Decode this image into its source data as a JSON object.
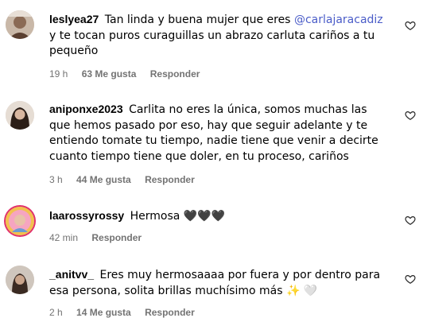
{
  "comments": [
    {
      "username": "leslyea27",
      "text_before": "Tan linda y buena mujer que eres ",
      "mention": "@carlajaracadiz",
      "text_after": " y te tocan puros curaguillas un abrazo carluta cariños a tu pequeño",
      "time": "19 h",
      "likes": "63 Me gusta",
      "reply": "Responder",
      "avatar_icon": "profile-photo",
      "heart_icon": "heart-outline-icon"
    },
    {
      "username": "aniponxe2023",
      "text": "Carlita no eres la única, somos muchas las que hemos pasado por eso, hay que seguir adelante y te entiendo tomate tu tiempo, nadie tiene que venir a decirte cuanto tiempo tiene que doler, en tu proceso, cariños",
      "time": "3 h",
      "likes": "44 Me gusta",
      "reply": "Responder",
      "avatar_icon": "profile-photo",
      "heart_icon": "heart-outline-icon"
    },
    {
      "username": "laarossyrossy",
      "text": "Hermosa 🖤🖤🖤",
      "time": "42 min",
      "reply": "Responder",
      "avatar_icon": "profile-photo-story-ring",
      "heart_icon": "heart-outline-icon"
    },
    {
      "username": "_anitvv_",
      "text": "Eres muy hermosaaaa por fuera y por dentro para esa persona, solita brillas muchísimo más ✨ 🤍",
      "time": "2 h",
      "likes": "14 Me gusta",
      "reply": "Responder",
      "avatar_icon": "profile-photo",
      "heart_icon": "heart-outline-icon"
    }
  ],
  "colors": {
    "meta_text": "#737373",
    "mention": "#4a5cc8",
    "story_ring": "#e1306c"
  }
}
